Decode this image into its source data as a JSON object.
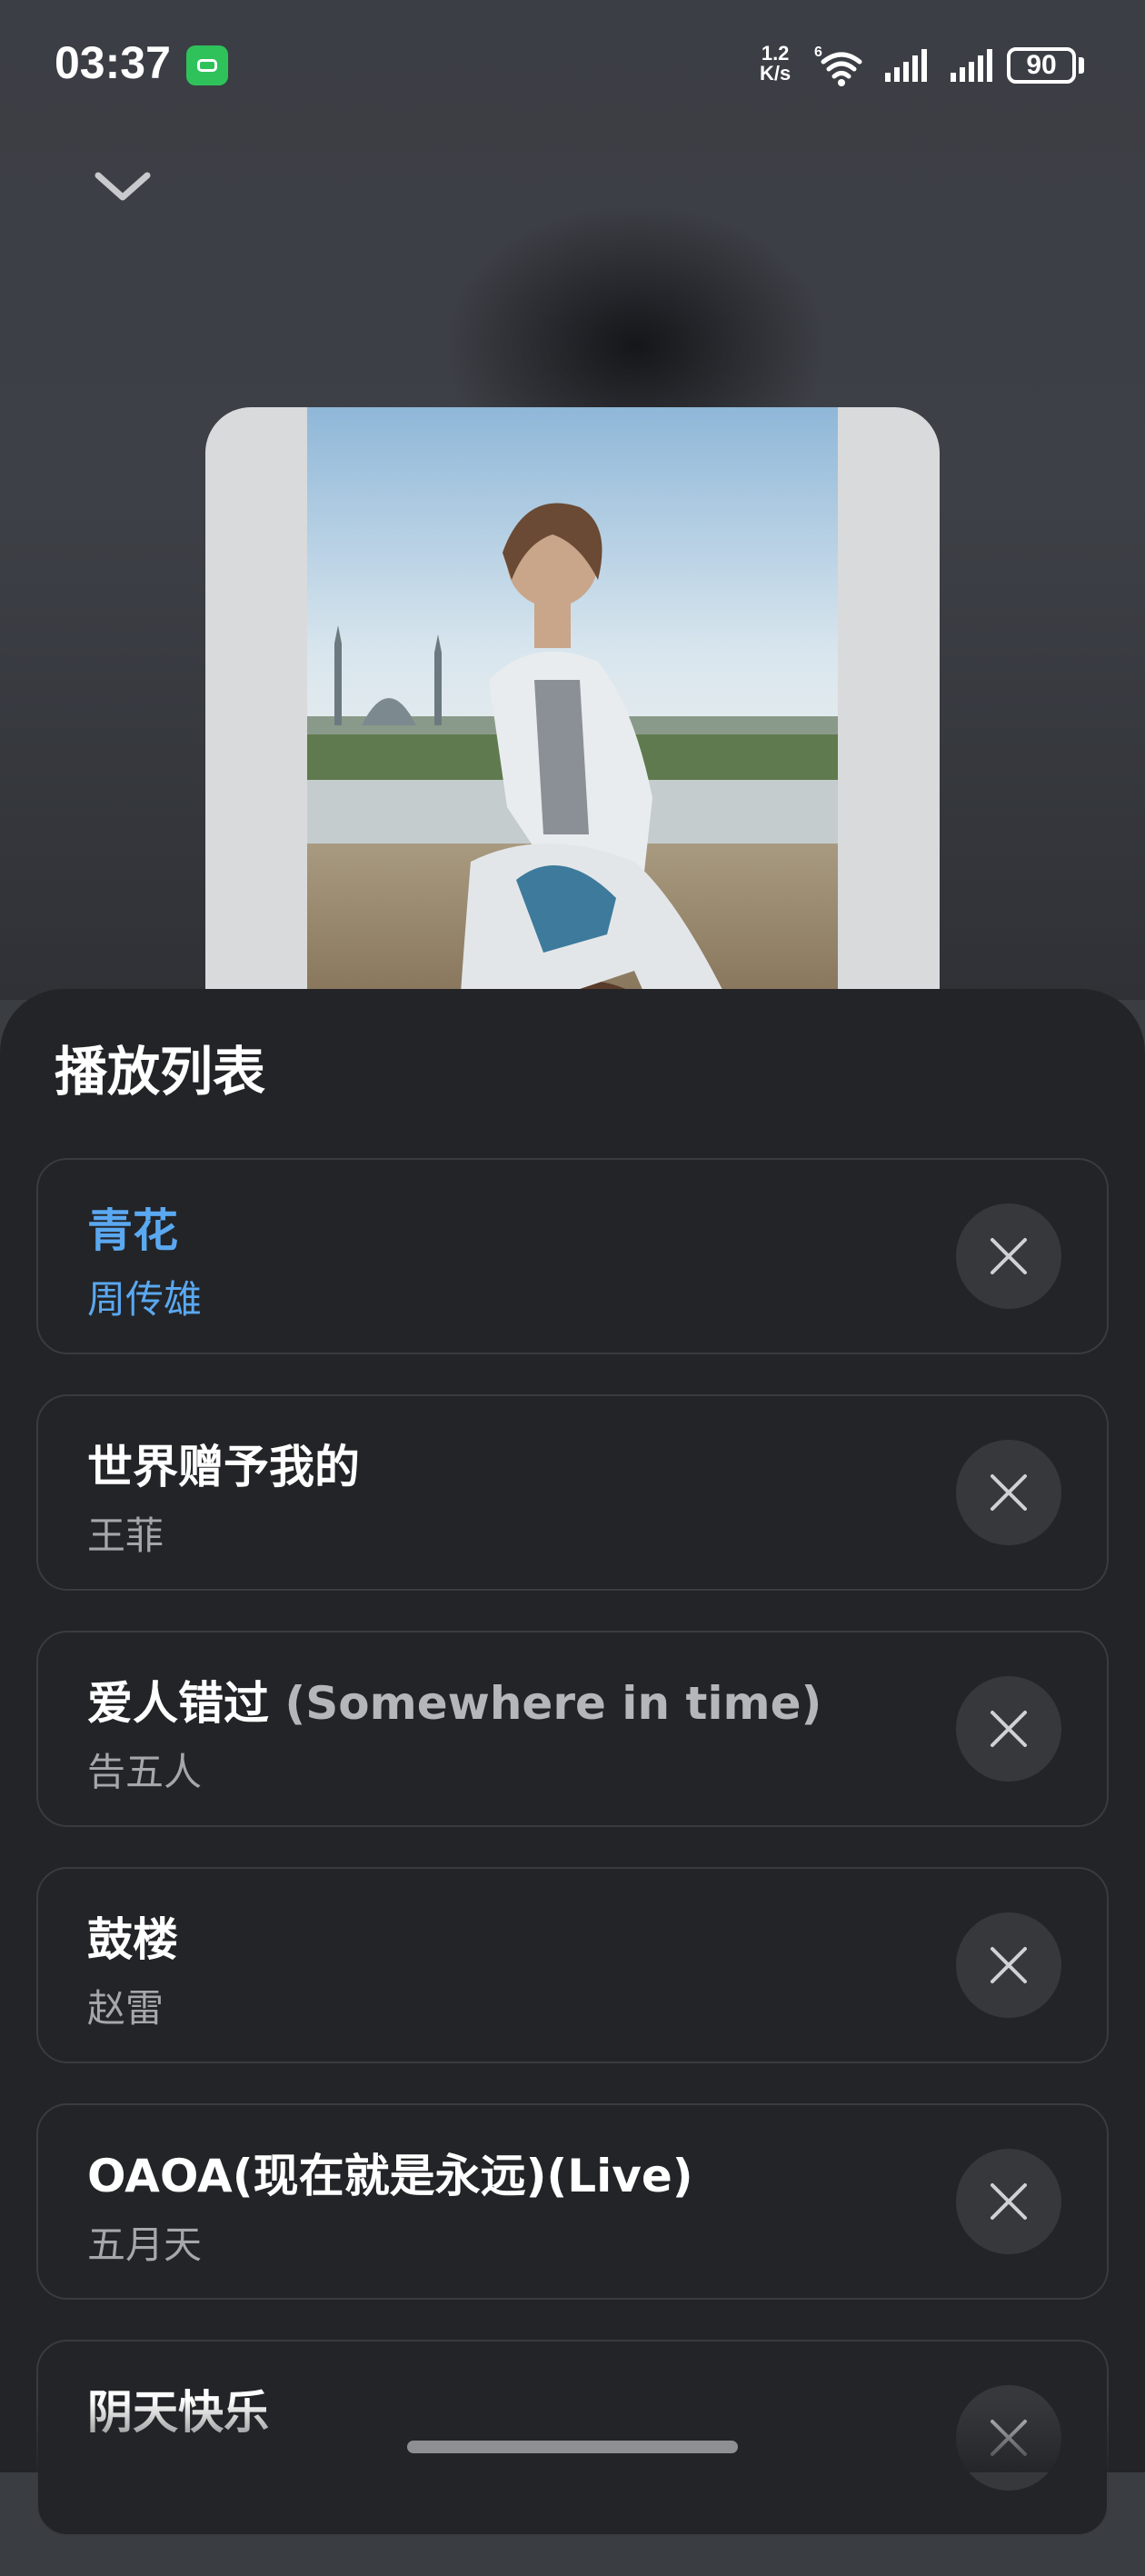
{
  "status_bar": {
    "time": "03:37",
    "net_speed_value": "1.2",
    "net_speed_unit": "K/s",
    "wifi_badge": "6",
    "battery": "90"
  },
  "header": {
    "collapse_icon": "chevron-down-icon"
  },
  "playlist": {
    "title": "播放列表",
    "items": [
      {
        "title": "青花",
        "title_sub": "",
        "artist": "周传雄",
        "active": true
      },
      {
        "title": "世界赠予我的",
        "title_sub": "",
        "artist": "王菲",
        "active": false
      },
      {
        "title": "爱人错过",
        "title_sub": " (Somewhere in time)",
        "artist": "告五人",
        "active": false
      },
      {
        "title": "鼓楼",
        "title_sub": "",
        "artist": "赵雷",
        "active": false
      },
      {
        "title": "OAOA(现在就是永远)(Live)",
        "title_sub": "",
        "artist": "五月天",
        "active": false
      },
      {
        "title": "阴天快乐",
        "title_sub": "",
        "artist": "",
        "active": false
      }
    ]
  },
  "colors": {
    "accent": "#5aa8f0",
    "sheet_bg": "#232427",
    "app_icon": "#2fc25b"
  }
}
